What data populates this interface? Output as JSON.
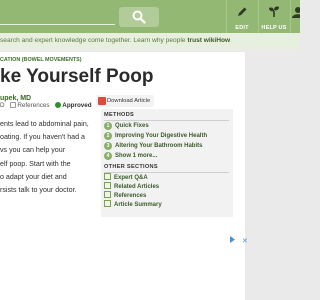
{
  "header": {
    "search_button_icon": "search-icon",
    "items": [
      {
        "label": "EDIT",
        "icon": "pencil-icon"
      },
      {
        "label": "HELP US",
        "icon": "seedling-icon"
      },
      {
        "label": "",
        "icon": "user-icon"
      }
    ]
  },
  "tagline": {
    "text": "search and expert knowledge come together. Learn why people ",
    "bold": "trust wikiHow"
  },
  "article": {
    "breadcrumb": "CATION (BOWEL MOVEMENTS)",
    "title": "ke Yourself Poop",
    "author": "upek, MD",
    "author_suffix": "D",
    "references_label": "References",
    "approved_label": "Approved",
    "intro_lines": [
      "ents lead to abdominal pain,",
      "oating. If you haven't had a",
      "vs you can help your",
      "elf poop. Start with the",
      "o adapt your diet and",
      "rsists talk to your doctor."
    ]
  },
  "download": {
    "label": "Download Article",
    "icon": "pdf-icon"
  },
  "toc": {
    "methods_heading": "METHODS",
    "methods": [
      {
        "num": "1",
        "label": "Quick Fixes"
      },
      {
        "num": "2",
        "label": "Improving Your Digestive Health"
      },
      {
        "num": "3",
        "label": "Altering Your Bathroom Habits"
      },
      {
        "num": "4",
        "label": "Show 1 more..."
      }
    ],
    "other_heading": "OTHER SECTIONS",
    "other": [
      {
        "label": "Expert Q&A",
        "icon": "question-icon"
      },
      {
        "label": "Related Articles",
        "icon": "document-icon"
      },
      {
        "label": "References",
        "icon": "document-icon"
      },
      {
        "label": "Article Summary",
        "icon": "document-icon"
      }
    ]
  },
  "ad": {
    "info_icon": "info-icon",
    "close_icon": "close-icon",
    "close_glyph": "✕"
  },
  "colors": {
    "header": "#93b874",
    "accent_green": "#386b20",
    "card": "#ffffff"
  }
}
